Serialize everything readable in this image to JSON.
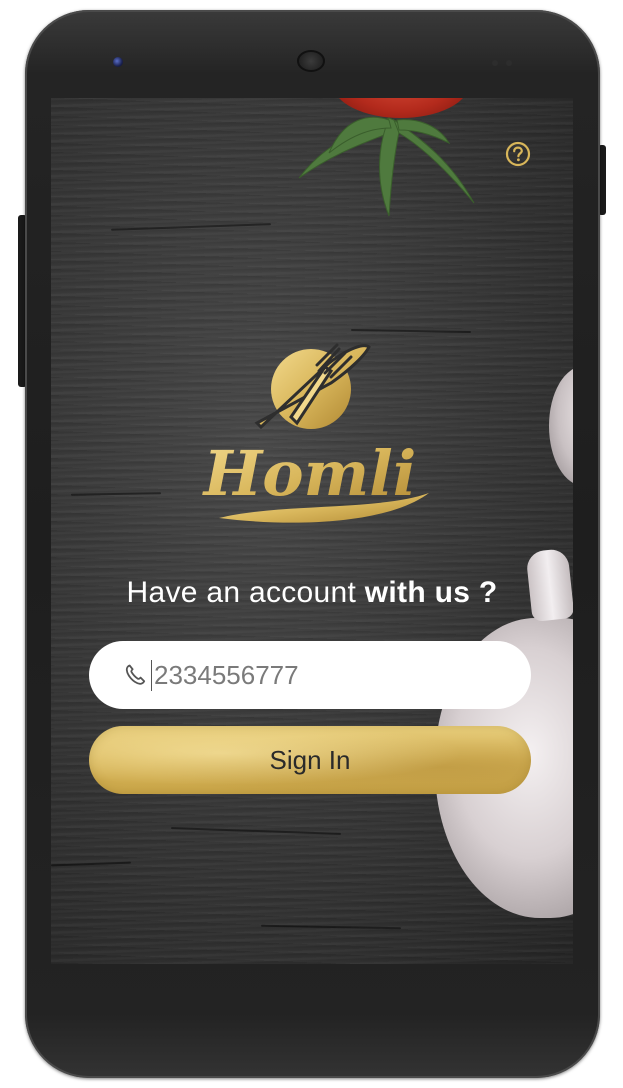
{
  "app": {
    "brand_name": "Homli"
  },
  "login": {
    "headline_regular": "Have an account ",
    "headline_bold": "with us ?",
    "phone_value": "2334556777",
    "sign_in_label": "Sign In"
  },
  "icons": {
    "help": "help-icon",
    "phone": "phone-icon",
    "logo": "fork-knife-logo-icon"
  },
  "colors": {
    "gold": "#d8b65a",
    "background": "#363636",
    "field": "#ffffff",
    "text_light": "#ffffff"
  }
}
